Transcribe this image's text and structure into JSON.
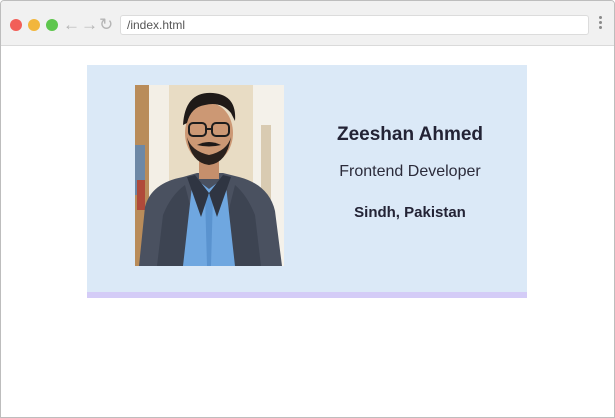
{
  "browser": {
    "address": "/index.html",
    "back_glyph": "←",
    "forward_glyph": "→",
    "reload_glyph": "↻",
    "icons": [
      "close-dot-icon",
      "minimize-dot-icon",
      "maximize-dot-icon",
      "back-arrow-icon",
      "forward-arrow-icon",
      "reload-icon",
      "kebab-menu-icon"
    ]
  },
  "profile": {
    "name": "Zeeshan Ahmed",
    "role": "Frontend Developer",
    "location": "Sindh, Pakistan"
  },
  "colors": {
    "card_background": "#dbe9f7",
    "card_bottom_border": "#d4ccf7",
    "text_dark": "#232335"
  }
}
